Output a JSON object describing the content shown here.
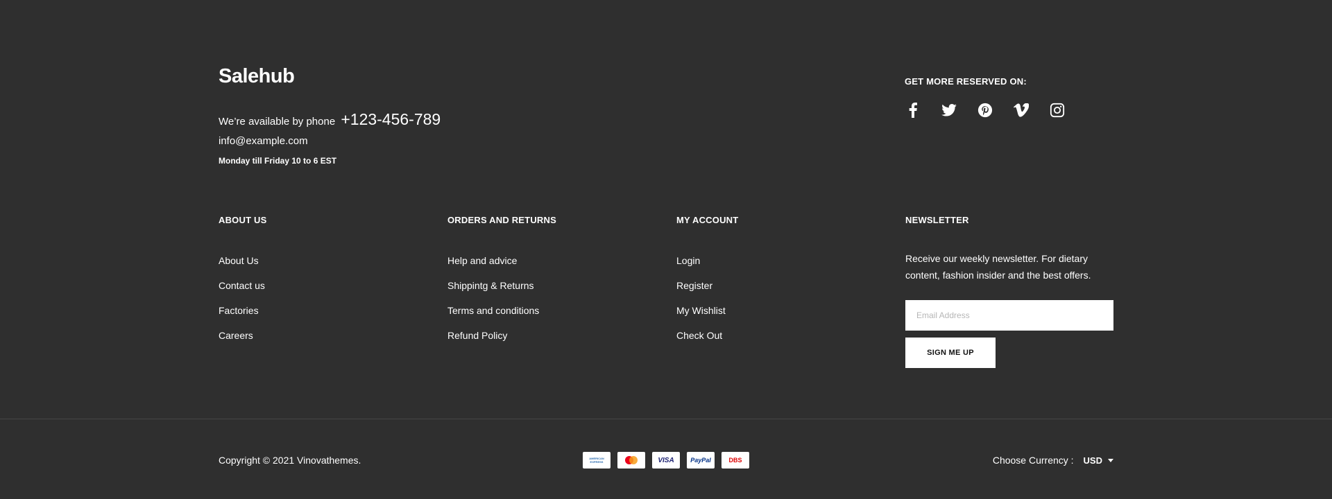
{
  "brand": {
    "name": "Salehub"
  },
  "contact": {
    "phone_prefix": "We’re available by phone",
    "phone": "+123-456-789",
    "email": "info@example.com",
    "hours": "Monday till Friday 10 to 6 EST"
  },
  "social": {
    "title": "GET MORE RESERVED ON:",
    "icons": [
      "facebook-icon",
      "twitter-icon",
      "pinterest-icon",
      "vimeo-icon",
      "instagram-icon"
    ]
  },
  "columns": {
    "about": {
      "title": "ABOUT US",
      "links": [
        "About Us",
        "Contact us",
        "Factories",
        "Careers"
      ]
    },
    "orders": {
      "title": "ORDERS AND RETURNS",
      "links": [
        "Help and advice",
        "Shippintg & Returns",
        "Terms and conditions",
        "Refund Policy"
      ]
    },
    "account": {
      "title": "MY ACCOUNT",
      "links": [
        "Login",
        "Register",
        "My Wishlist",
        "Check Out"
      ]
    },
    "newsletter": {
      "title": "NEWSLETTER",
      "description": "Receive our weekly newsletter. For dietary content, fashion insider and the best offers.",
      "email_placeholder": "Email Address",
      "button_label": "SIGN ME UP"
    }
  },
  "bottom": {
    "copyright": "Copyright © 2021 Vinovathemes.",
    "payments": [
      "AMERICAN EXPRESS",
      "Mastercard",
      "VISA",
      "PayPal",
      "DBS"
    ],
    "currency_label": "Choose Currency :",
    "currency_value": "USD"
  },
  "colors": {
    "background": "#2f2f2f",
    "text": "#ffffff",
    "divider": "#454545"
  }
}
